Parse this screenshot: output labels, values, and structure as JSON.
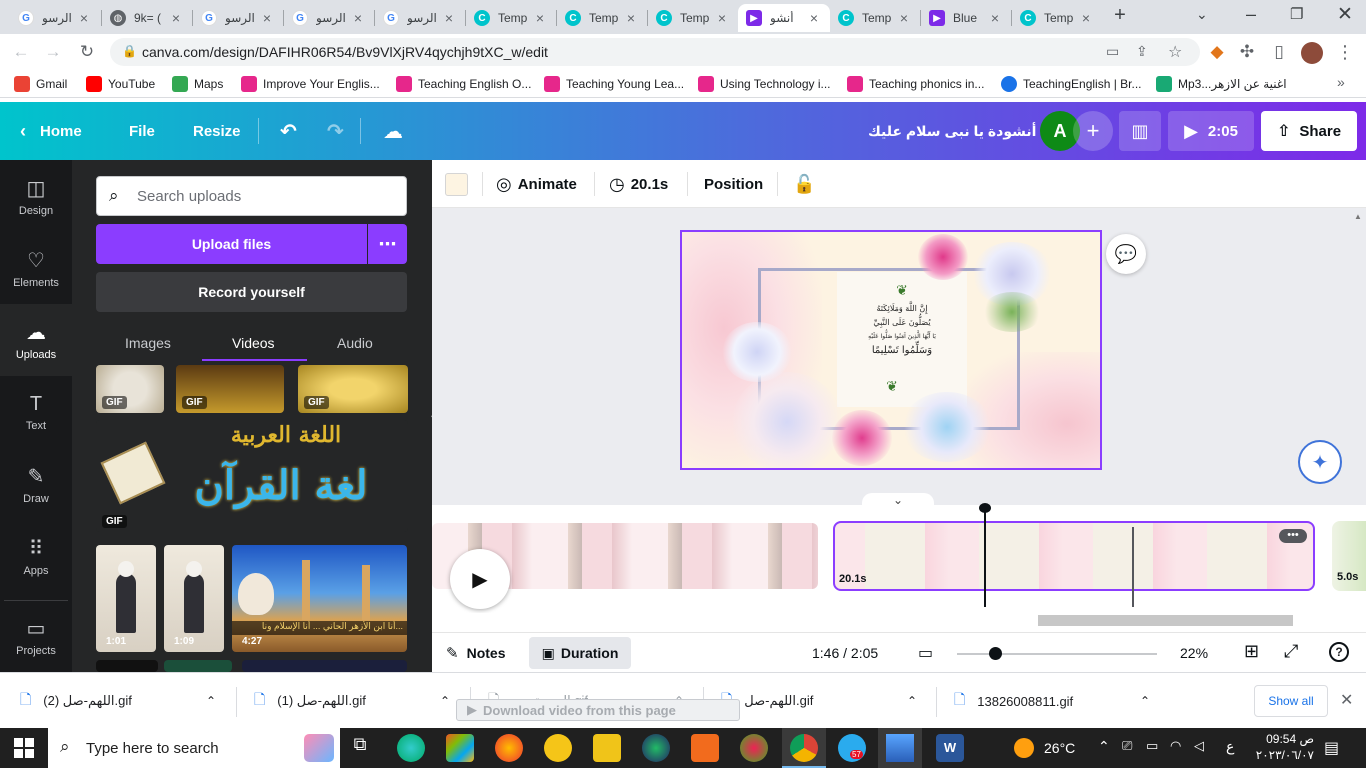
{
  "browser": {
    "tabs": [
      {
        "title": "الرسو",
        "icon": "google-icon"
      },
      {
        "title": "9k= (",
        "icon": "globe-icon"
      },
      {
        "title": "الرسو",
        "icon": "google-icon"
      },
      {
        "title": "الرسو",
        "icon": "google-icon"
      },
      {
        "title": "الرسو",
        "icon": "google-icon"
      },
      {
        "title": "Temp",
        "icon": "canva-icon"
      },
      {
        "title": "Temp",
        "icon": "canva-icon"
      },
      {
        "title": "Temp",
        "icon": "canva-icon"
      },
      {
        "title": "أنشو",
        "icon": "video-icon"
      },
      {
        "title": "Temp",
        "icon": "canva-icon"
      },
      {
        "title": "Blue",
        "icon": "video-icon"
      },
      {
        "title": "Temp",
        "icon": "canva-icon"
      }
    ],
    "url": "canva.com/design/DAFIHR06R54/Bv9VlXjRV4qychjh9tXC_w/edit",
    "bookmarks": [
      {
        "label": "Gmail",
        "color": "#ea4335"
      },
      {
        "label": "YouTube",
        "color": "#ff0000"
      },
      {
        "label": "Maps",
        "color": "#34a853"
      },
      {
        "label": "Improve Your Englis...",
        "color": "#e6278b"
      },
      {
        "label": "Teaching English O...",
        "color": "#e6278b"
      },
      {
        "label": "Teaching Young Lea...",
        "color": "#e6278b"
      },
      {
        "label": "Using Technology i...",
        "color": "#e6278b"
      },
      {
        "label": "Teaching phonics in...",
        "color": "#e6278b"
      },
      {
        "label": "TeachingEnglish | Br...",
        "color": "#1a73e8"
      },
      {
        "label": "Mp3...اغنية عن الازهر",
        "color": "#19a974"
      }
    ]
  },
  "header": {
    "home": "Home",
    "file": "File",
    "resize": "Resize",
    "title": "أنشودة يا نبى سلام عليك",
    "avatar_letter": "A",
    "play_time": "2:05",
    "share": "Share"
  },
  "rail": [
    {
      "label": "Design",
      "icon": "design-icon"
    },
    {
      "label": "Elements",
      "icon": "elements-icon"
    },
    {
      "label": "Uploads",
      "icon": "uploads-icon"
    },
    {
      "label": "Text",
      "icon": "text-icon"
    },
    {
      "label": "Draw",
      "icon": "draw-icon"
    },
    {
      "label": "Apps",
      "icon": "apps-icon"
    },
    {
      "label": "Projects",
      "icon": "projects-icon"
    }
  ],
  "panel": {
    "search_placeholder": "Search uploads",
    "upload": "Upload files",
    "record": "Record yourself",
    "tabs": [
      "Images",
      "Videos",
      "Audio"
    ],
    "gif_label": "GIF",
    "big_text_top": "اللغة العربية",
    "big_text_bottom": "لغة القرآن",
    "video_durations": [
      "1:01",
      "1:09",
      "4:27"
    ],
    "video_caption": "أنا ابن الأزهر الحاني ... أنا الإسلام ونا..."
  },
  "toolbar": {
    "animate": "Animate",
    "duration": "20.1s",
    "position": "Position"
  },
  "canvas": {
    "verse": [
      "إِنَّ اللَّهَ وَمَلَائِكَتَهُ",
      "يُصَلُّونَ عَلَى النَّبِيِّ",
      "يَا أَيُّهَا الَّذِينَ آمَنُوا صَلُّوا عَلَيْهِ",
      "وَسَلِّمُوا تَسْلِيمًا"
    ]
  },
  "timeline": {
    "clip_duration": "20.1s",
    "next_clip_duration": "5.0s"
  },
  "bottombar": {
    "notes": "Notes",
    "duration": "Duration",
    "time": "1:46 / 2:05",
    "zoom": "22%"
  },
  "downloads": {
    "items": [
      "اللهم-صل (2).gif",
      "اللهم-صل (1).gif",
      "الجمعة-يوم.gif",
      "اللهم-صل.gif",
      "13826008811.gif"
    ],
    "show_all": "Show all",
    "overlay": "Download video from this page"
  },
  "taskbar": {
    "search_placeholder": "Type here to search",
    "weather": "26°C",
    "lang": "ع",
    "time": "09:54 ص",
    "date": "٢٠٢٣/٠٦/٠٧",
    "telegram_badge": "57"
  }
}
